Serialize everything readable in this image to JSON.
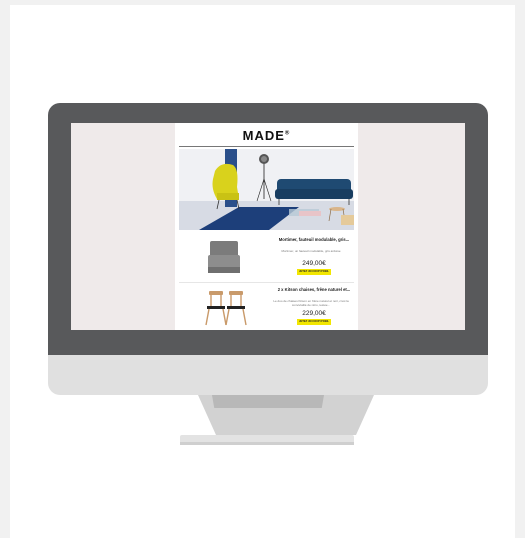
{
  "colors": {
    "bezel": "#58595b",
    "chin": "#e0e0e0",
    "screen_bg": "#efeaea",
    "button_yellow": "#f2e600",
    "sofa_blue": "#1f4a72",
    "armchair_yellow": "#d9d21c"
  },
  "email": {
    "logo": "MADE",
    "logo_mark": "®",
    "products": [
      {
        "title": "Mortimer, fauteuil modulable, gris...",
        "description": "Mortimer, un fauteuil modulable, gris ardoise",
        "price": "249,00€",
        "button": "JETEZ UN COUP D'OEIL"
      },
      {
        "title": "2 x Kitson chaises, frêne naturel et...",
        "description": "Le duo de chaises Kitson en frêne naturel et noir, c'est la convivialité de rétro, testée...",
        "price": "229,00€",
        "button": "JETEZ UN COUP D'OEIL"
      }
    ]
  },
  "icons": [
    "monitor-icon",
    "floor-lamp-icon",
    "armchair-icon",
    "sofa-icon",
    "chair-icon"
  ]
}
